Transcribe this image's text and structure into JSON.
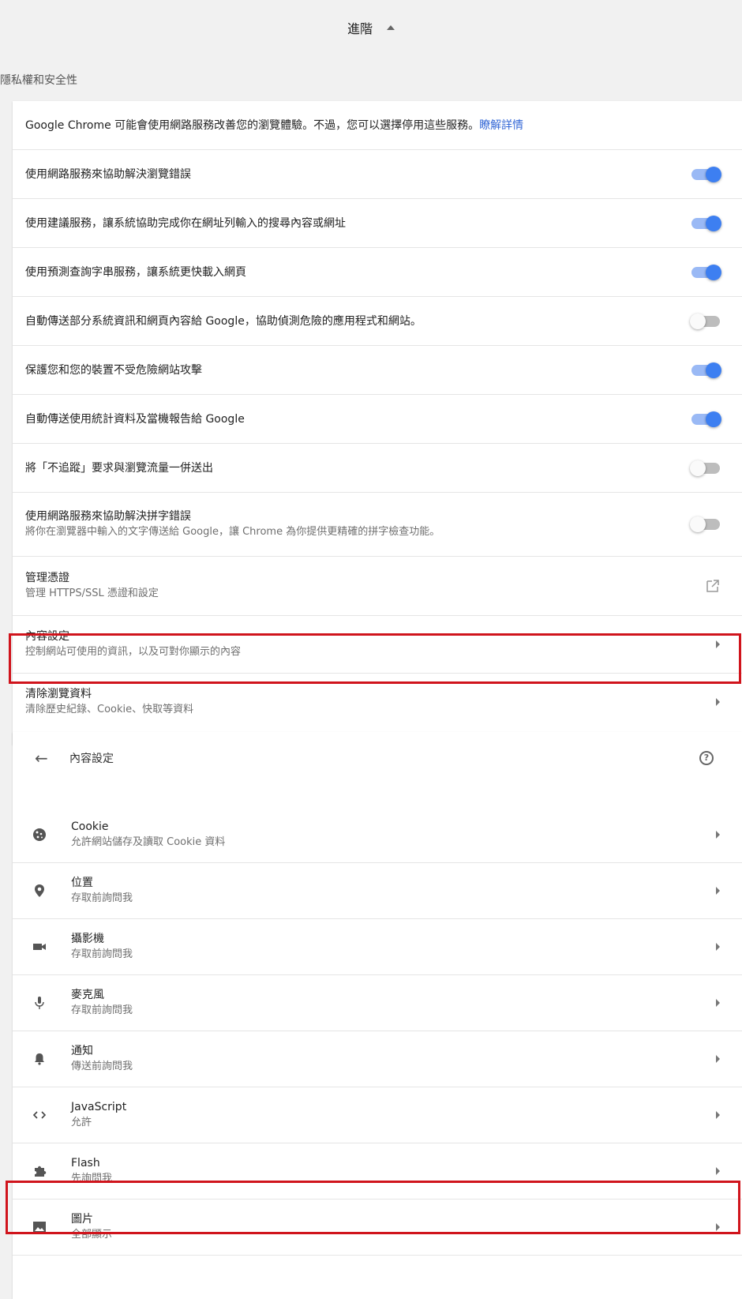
{
  "top": {
    "title": "進階"
  },
  "section_title": "隱私權和安全性",
  "privacy": {
    "intro_text": "Google Chrome 可能會使用網路服務改善您的瀏覽體驗。不過，您可以選擇停用這些服務。",
    "learn_more": "瞭解詳情",
    "toggles": [
      {
        "label": "使用網路服務來協助解決瀏覽錯誤",
        "on": true
      },
      {
        "label": "使用建議服務，讓系統協助完成你在網址列輸入的搜尋內容或網址",
        "on": true
      },
      {
        "label": "使用預測查詢字串服務，讓系統更快載入網頁",
        "on": true
      },
      {
        "label": "自動傳送部分系統資訊和網頁內容給 Google，協助偵測危險的應用程式和網站。",
        "on": false
      },
      {
        "label": "保護您和您的裝置不受危險網站攻擊",
        "on": true
      },
      {
        "label": "自動傳送使用統計資料及當機報告給 Google",
        "on": true
      },
      {
        "label": "將「不追蹤」要求與瀏覽流量一併送出",
        "on": false
      },
      {
        "label": "使用網路服務來協助解決拼字錯誤",
        "sub": "將你在瀏覽器中輸入的文字傳送給 Google，讓 Chrome 為你提供更精確的拼字檢查功能。",
        "on": false
      }
    ],
    "manage_certs": {
      "label": "管理憑證",
      "sub": "管理 HTTPS/SSL 憑證和設定"
    },
    "content_settings": {
      "label": "內容設定",
      "sub": "控制網站可使用的資訊，以及可對你顯示的內容"
    },
    "clear_data": {
      "label": "清除瀏覽資料",
      "sub": "清除歷史紀錄、Cookie、快取等資料"
    }
  },
  "content_page": {
    "title": "內容設定",
    "items": [
      {
        "label": "Cookie",
        "sub": "允許網站儲存及讀取 Cookie 資料",
        "icon": "cookie-icon"
      },
      {
        "label": "位置",
        "sub": "存取前詢問我",
        "icon": "location-icon"
      },
      {
        "label": "攝影機",
        "sub": "存取前詢問我",
        "icon": "camera-icon"
      },
      {
        "label": "麥克風",
        "sub": "存取前詢問我",
        "icon": "microphone-icon"
      },
      {
        "label": "通知",
        "sub": "傳送前詢問我",
        "icon": "bell-icon"
      },
      {
        "label": "JavaScript",
        "sub": "允許",
        "icon": "code-icon"
      },
      {
        "label": "Flash",
        "sub": "先詢問我",
        "icon": "puzzle-icon"
      },
      {
        "label": "圖片",
        "sub": "全部顯示",
        "icon": "image-icon"
      }
    ]
  },
  "colors": {
    "toggle_on": "#3d7ff1",
    "toggle_track_on": "#9ab9f5",
    "highlight": "#d0141c",
    "link": "#3367d6"
  }
}
